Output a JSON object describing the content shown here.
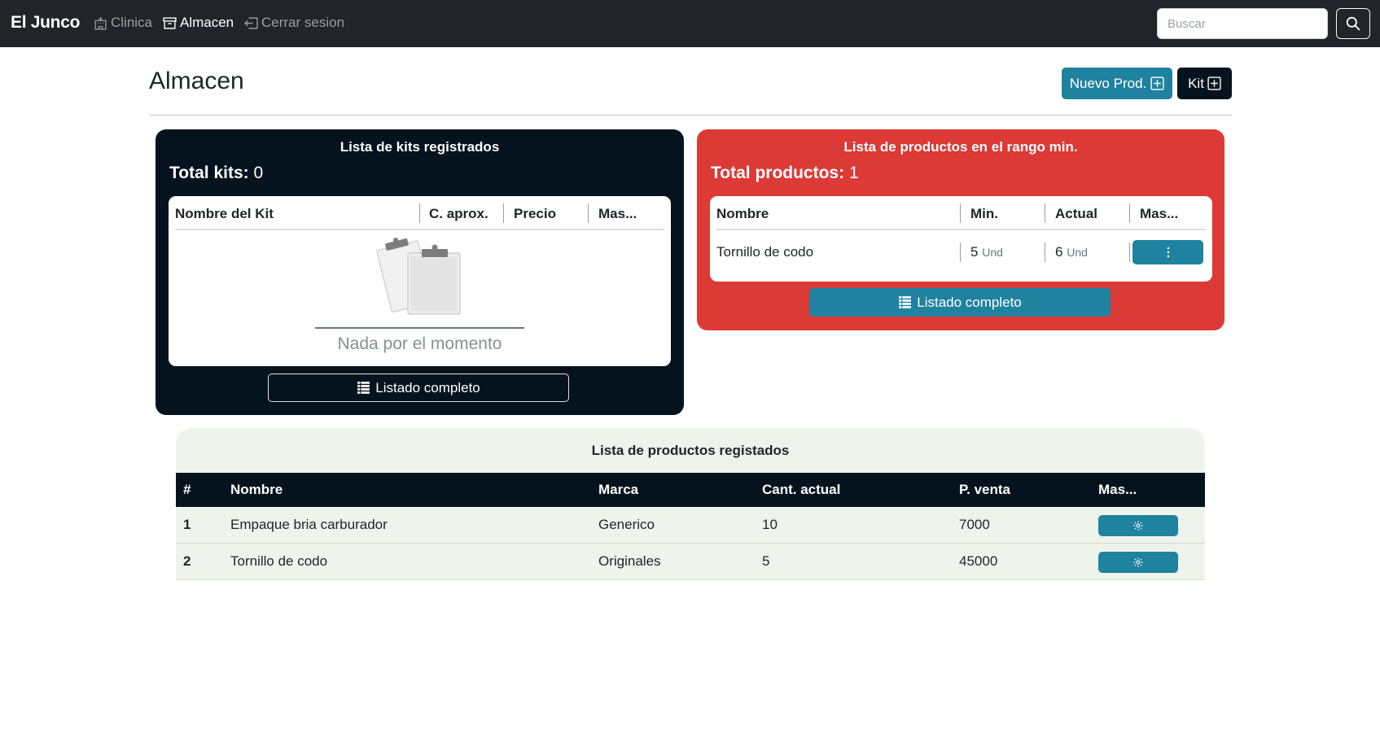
{
  "navbar": {
    "brand": "El Junco",
    "links": [
      {
        "label": "Clinica",
        "icon": "hospital-icon"
      },
      {
        "label": "Almacen",
        "icon": "archive-icon"
      },
      {
        "label": "Cerrar sesion",
        "icon": "logout-icon"
      }
    ],
    "search_placeholder": "Buscar",
    "search_value": ""
  },
  "header": {
    "title": "Almacen",
    "new_product_label": "Nuevo Prod.",
    "kit_label": "Kit"
  },
  "kits_card": {
    "title": "Lista de kits registrados",
    "total_label": "Total kits:",
    "total_value": "0",
    "columns": [
      "Nombre del Kit",
      "C. aprox.",
      "Precio",
      "Mas..."
    ],
    "empty_text": "Nada por el momento",
    "list_button": "Listado completo"
  },
  "min_card": {
    "title": "Lista de productos en el rango min.",
    "total_label": "Total productos:",
    "total_value": "1",
    "columns": [
      "Nombre",
      "Min.",
      "Actual",
      "Mas..."
    ],
    "rows": [
      {
        "name": "Tornillo de codo",
        "min": "5",
        "actual": "6",
        "unit": "Und"
      }
    ],
    "list_button": "Listado completo"
  },
  "products": {
    "title": "Lista de productos registados",
    "columns": [
      "#",
      "Nombre",
      "Marca",
      "Cant. actual",
      "P. venta",
      "Mas..."
    ],
    "rows": [
      {
        "num": "1",
        "name": "Empaque bria carburador",
        "brand": "Generico",
        "qty": "10",
        "price": "7000"
      },
      {
        "num": "2",
        "name": "Tornillo de codo",
        "brand": "Originales",
        "qty": "5",
        "price": "45000"
      }
    ]
  },
  "colors": {
    "navbar": "#212529",
    "primary": "#1f829e",
    "dark": "#05131e",
    "danger": "#dc3a36",
    "table_bg": "#eef4ec"
  }
}
